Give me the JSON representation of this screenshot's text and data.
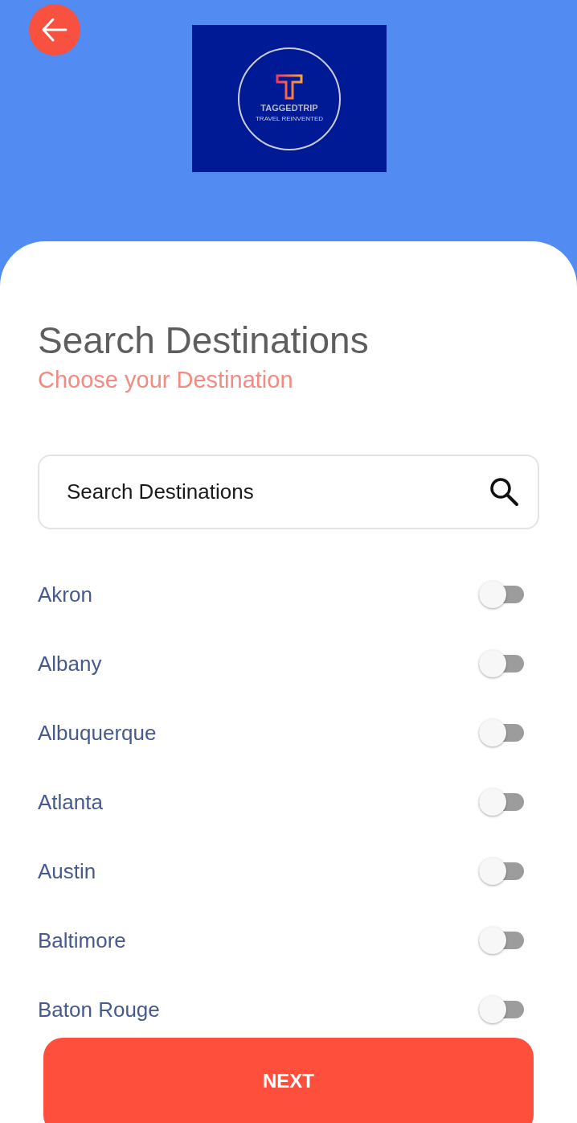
{
  "header": {
    "logo": {
      "name": "TAGGEDTRIP",
      "tagline": "TRAVEL REINVENTED"
    }
  },
  "title": "Search Destinations",
  "subtitle": "Choose your Destination",
  "search": {
    "placeholder": "Search Destinations"
  },
  "destinations": [
    {
      "name": "Akron",
      "on": false
    },
    {
      "name": "Albany",
      "on": false
    },
    {
      "name": "Albuquerque",
      "on": false
    },
    {
      "name": "Atlanta",
      "on": false
    },
    {
      "name": "Austin",
      "on": false
    },
    {
      "name": "Baltimore",
      "on": false
    },
    {
      "name": "Baton Rouge",
      "on": false
    }
  ],
  "next_button": "NEXT"
}
